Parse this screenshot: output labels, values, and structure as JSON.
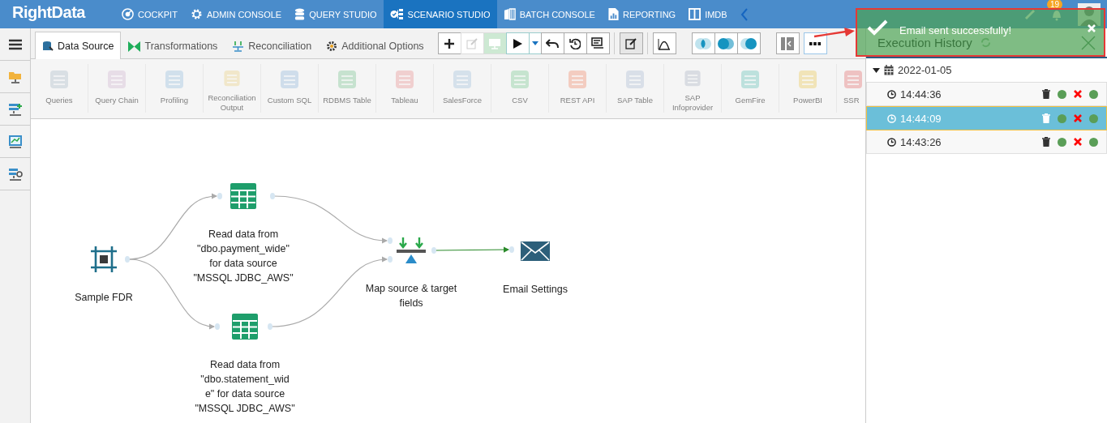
{
  "nav": {
    "logo": "RightData",
    "items": [
      {
        "label": "COCKPIT",
        "kind": "gauge",
        "selected": false
      },
      {
        "label": "ADMIN CONSOLE",
        "kind": "gear",
        "selected": false
      },
      {
        "label": "QUERY STUDIO",
        "kind": "database",
        "selected": false
      },
      {
        "label": "SCENARIO STUDIO",
        "kind": "flow",
        "selected": true
      },
      {
        "label": "BATCH CONSOLE",
        "kind": "book",
        "selected": false
      },
      {
        "label": "REPORTING",
        "kind": "report",
        "selected": false
      },
      {
        "label": "IMDB",
        "kind": "columns",
        "selected": false
      }
    ],
    "notification_count": "19"
  },
  "toast": {
    "message": "Email sent successfully!"
  },
  "tabs": [
    {
      "label": "Data Source",
      "kind": "datasource",
      "selected": true
    },
    {
      "label": "Transformations",
      "kind": "bowtie",
      "selected": false
    },
    {
      "label": "Reconciliation",
      "kind": "balance",
      "selected": false
    },
    {
      "label": "Additional Options",
      "kind": "gear",
      "selected": false
    }
  ],
  "palette": [
    {
      "label": "Queries"
    },
    {
      "label": "Query Chain"
    },
    {
      "label": "Profiling"
    },
    {
      "label": "Reconciliation Output"
    },
    {
      "label": "Custom SQL"
    },
    {
      "label": "RDBMS Table"
    },
    {
      "label": "Tableau"
    },
    {
      "label": "SalesForce"
    },
    {
      "label": "CSV"
    },
    {
      "label": "REST API"
    },
    {
      "label": "SAP Table"
    },
    {
      "label": "SAP Infoprovider"
    },
    {
      "label": "GemFire"
    },
    {
      "label": "PowerBI"
    },
    {
      "label": "SSR"
    }
  ],
  "canvas": {
    "nodes": [
      {
        "kind": "source",
        "label": "Sample FDR"
      },
      {
        "kind": "table",
        "label": "Read data from\n\"dbo.payment_wide\"\nfor data source\n\"MSSQL JDBC_AWS\""
      },
      {
        "kind": "table",
        "label": "Read data from\n\"dbo.statement_wid\ne\" for data source\n\"MSSQL JDBC_AWS\""
      },
      {
        "kind": "map",
        "label": "Map source & target\nfields"
      },
      {
        "kind": "email",
        "label": "Email Settings"
      }
    ]
  },
  "history": {
    "title": "Execution History",
    "groups": [
      {
        "date": "2022-01-05",
        "expanded": true,
        "runs": [
          {
            "time": "14:44:36",
            "selected": false
          },
          {
            "time": "14:44:09",
            "selected": true
          },
          {
            "time": "14:43:26",
            "selected": false
          }
        ]
      }
    ]
  }
}
